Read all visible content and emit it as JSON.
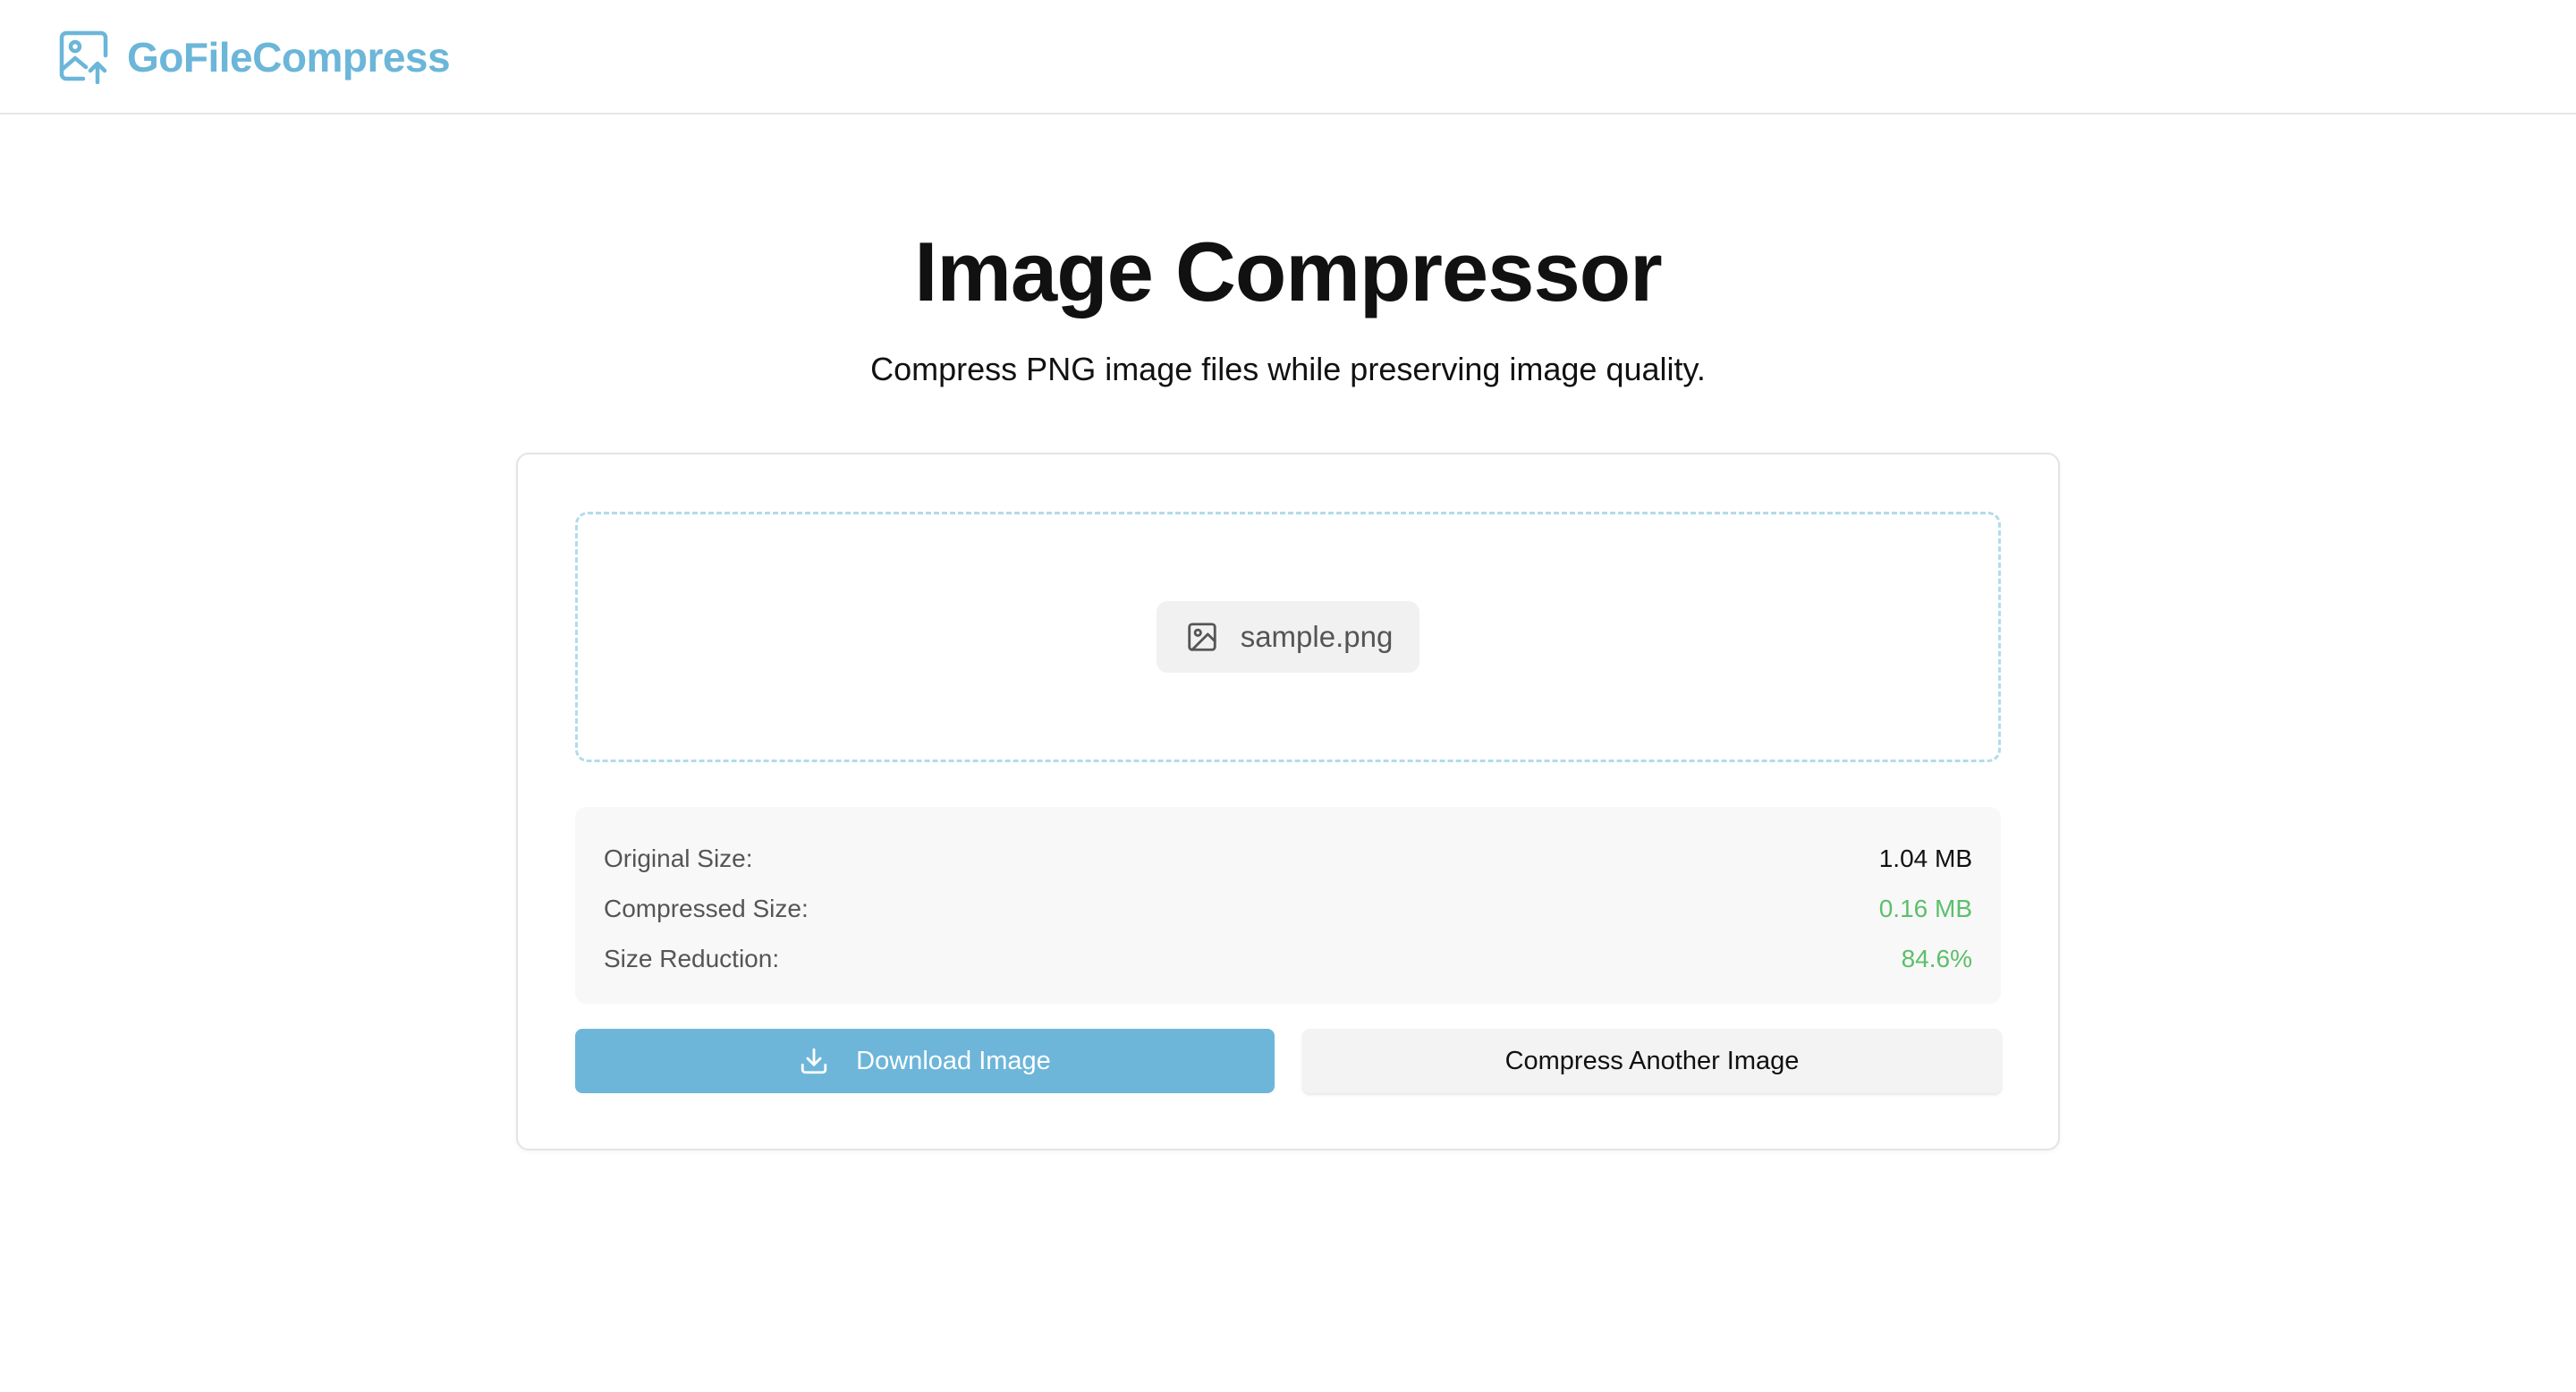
{
  "header": {
    "brand_name": "GoFileCompress",
    "brand_icon": "image-upload-icon",
    "brand_color": "#6bb6d9"
  },
  "main": {
    "title": "Image Compressor",
    "subtitle": "Compress PNG image files while preserving image quality."
  },
  "dropzone": {
    "file_icon": "image-file-icon",
    "file_name": "sample.png"
  },
  "stats": {
    "original_label": "Original Size:",
    "original_value": "1.04 MB",
    "compressed_label": "Compressed Size:",
    "compressed_value": "0.16 MB",
    "reduction_label": "Size Reduction:",
    "reduction_value": "84.6%",
    "highlight_color": "#5cbf6b"
  },
  "actions": {
    "download_label": "Download Image",
    "download_icon": "download-icon",
    "another_label": "Compress Another Image",
    "primary_color": "#6db6da"
  }
}
